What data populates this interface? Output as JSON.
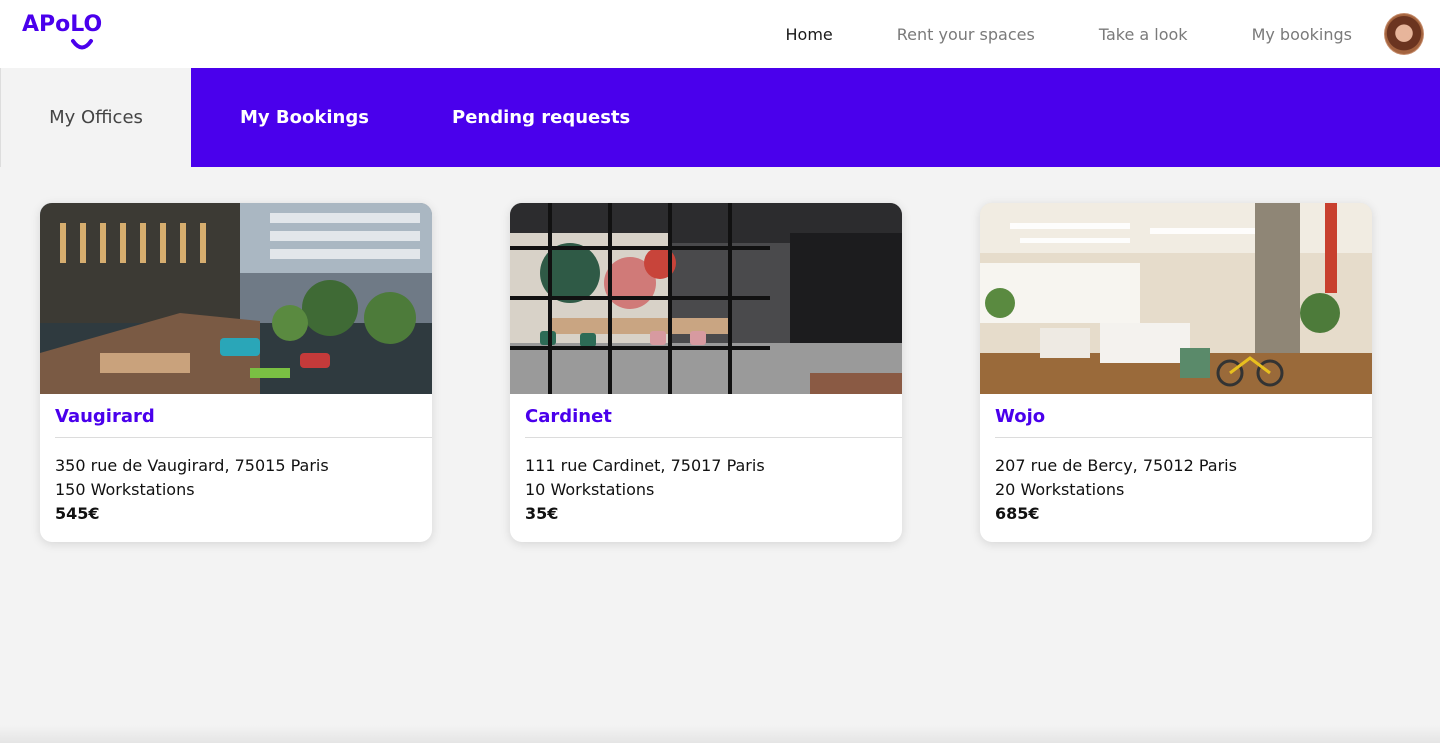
{
  "brand": {
    "logo_text": "APoLO",
    "color": "#4a00ec"
  },
  "nav": {
    "items": [
      {
        "label": "Home",
        "active": true
      },
      {
        "label": "Rent your spaces",
        "active": false
      },
      {
        "label": "Take a look",
        "active": false
      },
      {
        "label": "My bookings",
        "active": false
      }
    ]
  },
  "tabs": [
    {
      "label": "My Offices",
      "selected": true
    },
    {
      "label": "My Bookings",
      "selected": false
    },
    {
      "label": "Pending requests",
      "selected": false
    }
  ],
  "offices": [
    {
      "name": "Vaugirard",
      "address": "350 rue de Vaugirard, 75015 Paris",
      "workstations": "150 Workstations",
      "price": "545€",
      "photo": "atrium-office-photo"
    },
    {
      "name": "Cardinet",
      "address": "111 rue Cardinet, 75017 Paris",
      "workstations": "10 Workstations",
      "price": "35€",
      "photo": "meeting-room-photo"
    },
    {
      "name": "Wojo",
      "address": "207 rue de Bercy, 75012 Paris",
      "workstations": "20 Workstations",
      "price": "685€",
      "photo": "open-space-photo"
    }
  ],
  "colors": {
    "accent": "#4a00ec",
    "background": "#f3f3f3",
    "card": "#ffffff"
  }
}
